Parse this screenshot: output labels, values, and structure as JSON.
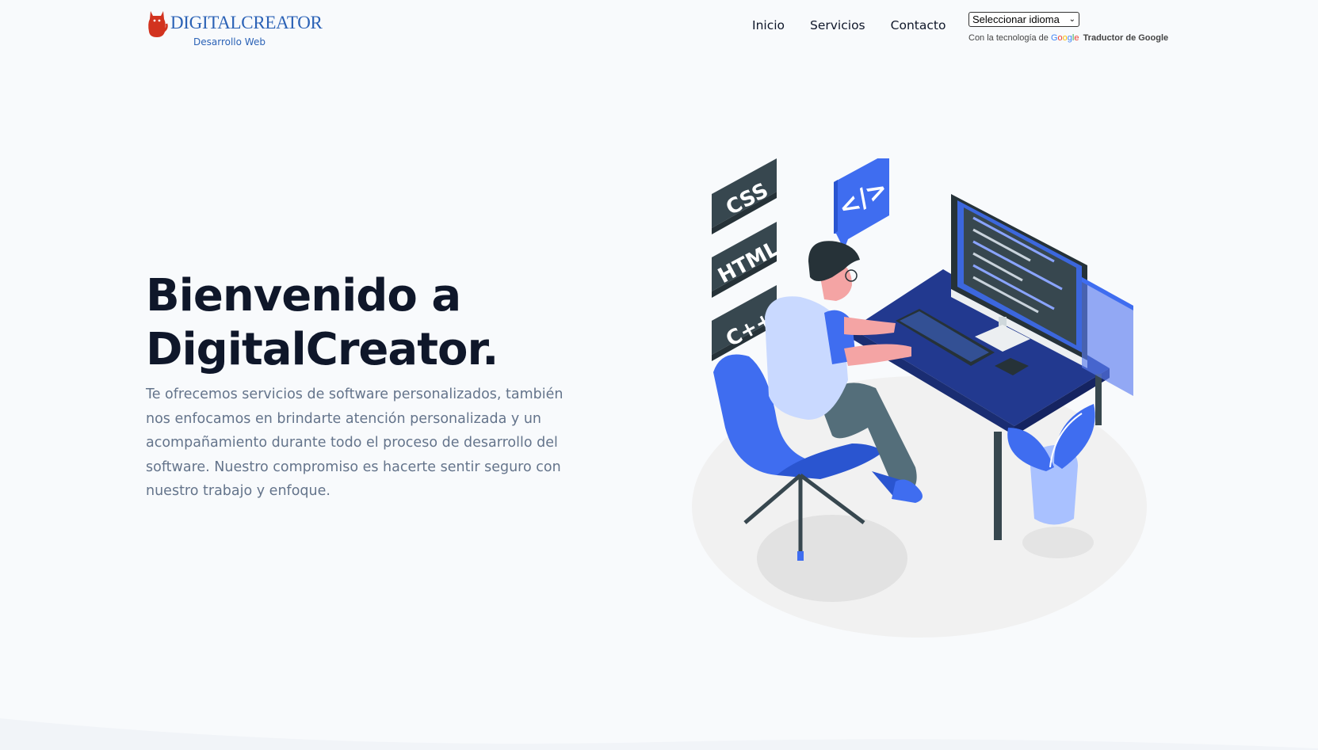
{
  "brand": {
    "name": "DIGITALCREATOR",
    "tagline": "Desarrollo Web"
  },
  "nav": {
    "items": [
      {
        "label": "Inicio"
      },
      {
        "label": "Servicios"
      },
      {
        "label": "Contacto"
      }
    ]
  },
  "translate": {
    "select_value": "Seleccionar idioma",
    "powered_prefix": "Con la tecnología de",
    "google": "Google",
    "service": "Traductor de Google"
  },
  "hero": {
    "title_line1": "Bienvenido a",
    "title_line2": "DigitalCreator.",
    "description": "Te ofrecemos servicios de software personalizados, también nos enfocamos en brindarte atención personalizada y un acompañamiento durante todo el proceso de desarrollo del software. Nuestro compromiso es hacerte sentir seguro con nuestro trabajo y enfoque."
  },
  "illustration": {
    "badges": [
      "CSS",
      "HTML",
      "C++"
    ],
    "code_bubble": "</>"
  },
  "colors": {
    "brand_blue": "#2b62b6",
    "accent_blue": "#3f6df0",
    "dark_navy": "#1e3a8a",
    "badge_dark": "#37474f",
    "text_dark": "#0f172a",
    "text_muted": "#64748b",
    "logo_red": "#d2331f"
  }
}
